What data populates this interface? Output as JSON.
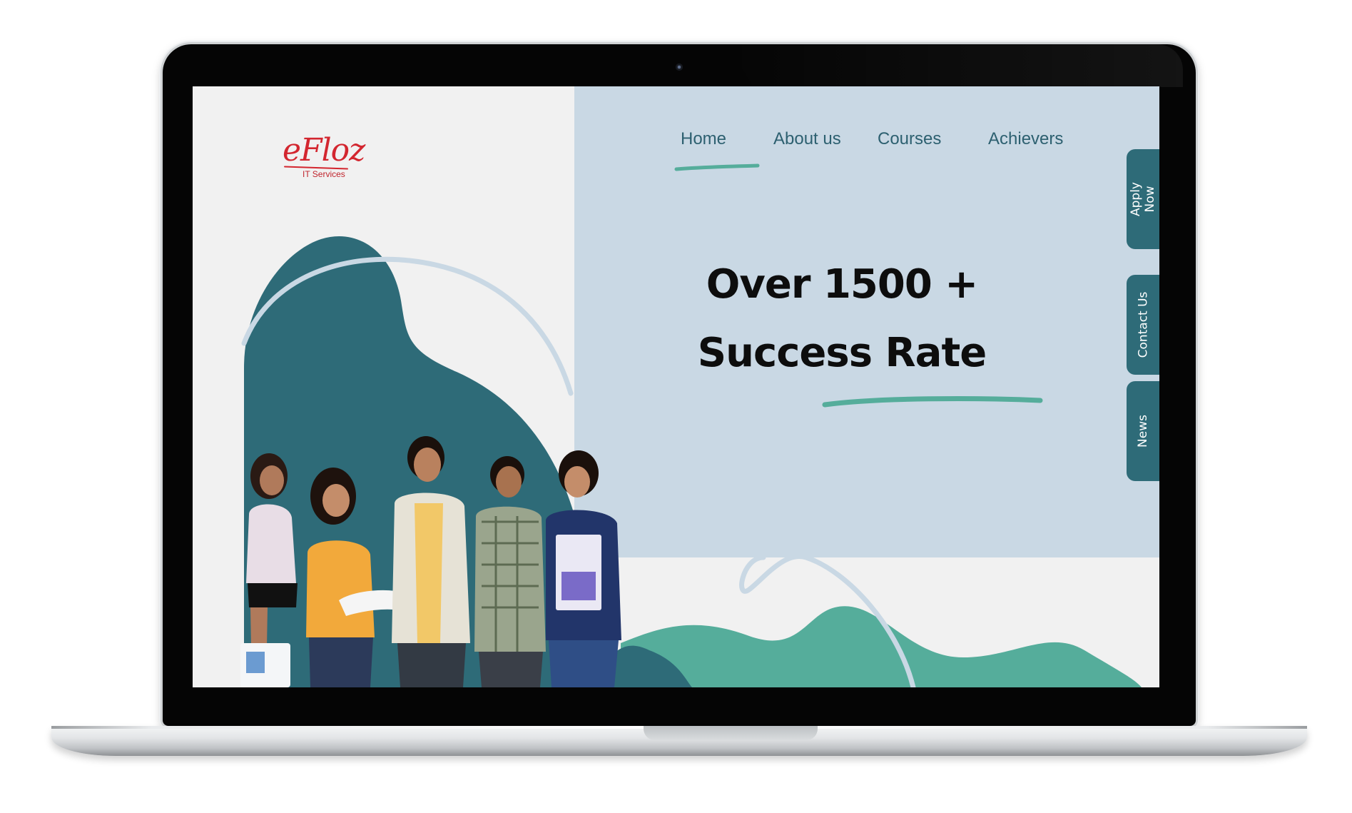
{
  "logo": {
    "text": "eFloz",
    "subtitle": "IT Services"
  },
  "nav": {
    "items": [
      {
        "label": "Home",
        "active": true
      },
      {
        "label": "About us"
      },
      {
        "label": "Courses"
      },
      {
        "label": "Achievers"
      }
    ]
  },
  "hero": {
    "line1": "Over 1500 +",
    "line2": "Success Rate"
  },
  "side_tabs": {
    "apply": "Apply Now",
    "contact": "Contact Us",
    "news": "News"
  },
  "colors": {
    "brand_red": "#d3262f",
    "teal_dark": "#2e6b78",
    "teal_green": "#55ad9b",
    "hero_bg": "#c9d8e4",
    "page_bg": "#f1f1f1"
  }
}
